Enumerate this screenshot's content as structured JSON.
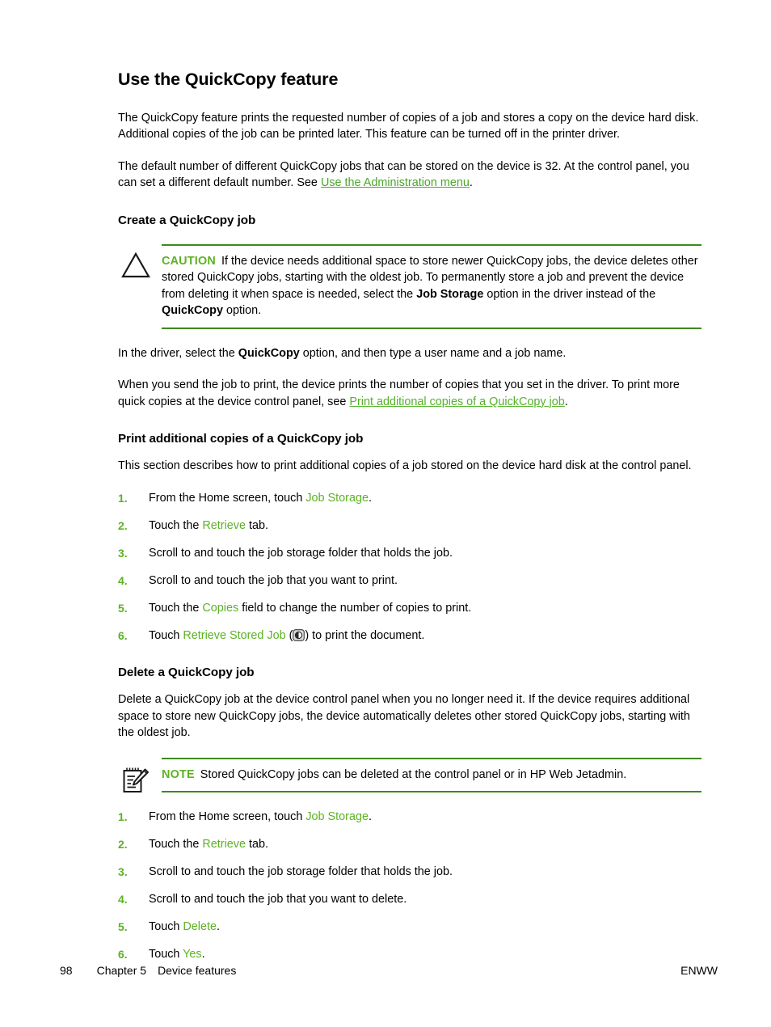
{
  "page": {
    "title": "Use the QuickCopy feature",
    "intro_paragraph": "The QuickCopy feature prints the requested number of copies of a job and stores a copy on the device hard disk. Additional copies of the job can be printed later. This feature can be turned off in the printer driver.",
    "default_paragraph_before_link": "The default number of different QuickCopy jobs that can be stored on the device is 32. At the control panel, you can set a different default number. See ",
    "default_paragraph_link": "Use the Administration menu",
    "default_paragraph_after_link": "."
  },
  "create_section": {
    "heading": "Create a QuickCopy job",
    "caution": {
      "icon": "caution-triangle-icon",
      "label": "CAUTION",
      "text_part1": "If the device needs additional space to store newer QuickCopy jobs, the device deletes other stored QuickCopy jobs, starting with the oldest job. To permanently store a job and prevent the device from deleting it when space is needed, select the ",
      "bold1": "Job Storage",
      "text_part2": " option in the driver instead of the ",
      "bold2": "QuickCopy",
      "text_part3": " option."
    },
    "driver_paragraph_part1": "In the driver, select the ",
    "driver_paragraph_bold": "QuickCopy",
    "driver_paragraph_part2": " option, and then type a user name and a job name.",
    "send_paragraph_before_link": "When you send the job to print, the device prints the number of copies that you set in the driver. To print more quick copies at the device control panel, see ",
    "send_paragraph_link": "Print additional copies of a QuickCopy job",
    "send_paragraph_after_link": "."
  },
  "print_section": {
    "heading": "Print additional copies of a QuickCopy job",
    "intro": "This section describes how to print additional copies of a job stored on the device hard disk at the control panel.",
    "steps": [
      {
        "num": "1.",
        "pre": "From the Home screen, touch ",
        "ui": "Job Storage",
        "post": "."
      },
      {
        "num": "2.",
        "pre": "Touch the ",
        "ui": "Retrieve",
        "post": " tab."
      },
      {
        "num": "3.",
        "pre": "Scroll to and touch the job storage folder that holds the job.",
        "ui": "",
        "post": ""
      },
      {
        "num": "4.",
        "pre": "Scroll to and touch the job that you want to print.",
        "ui": "",
        "post": ""
      },
      {
        "num": "5.",
        "pre": "Touch the ",
        "ui": "Copies",
        "post": " field to change the number of copies to print."
      },
      {
        "num": "6.",
        "pre": "Touch ",
        "ui": "Retrieve Stored Job",
        "post": " (",
        "icon": "start-button-icon",
        "post2": ") to print the document."
      }
    ]
  },
  "delete_section": {
    "heading": "Delete a QuickCopy job",
    "intro": "Delete a QuickCopy job at the device control panel when you no longer need it. If the device requires additional space to store new QuickCopy jobs, the device automatically deletes other stored QuickCopy jobs, starting with the oldest job.",
    "note": {
      "icon": "note-pad-pencil-icon",
      "label": "NOTE",
      "text": "Stored QuickCopy jobs can be deleted at the control panel or in HP Web Jetadmin."
    },
    "steps": [
      {
        "num": "1.",
        "pre": "From the Home screen, touch ",
        "ui": "Job Storage",
        "post": "."
      },
      {
        "num": "2.",
        "pre": "Touch the ",
        "ui": "Retrieve",
        "post": " tab."
      },
      {
        "num": "3.",
        "pre": "Scroll to and touch the job storage folder that holds the job.",
        "ui": "",
        "post": ""
      },
      {
        "num": "4.",
        "pre": "Scroll to and touch the job that you want to delete.",
        "ui": "",
        "post": ""
      },
      {
        "num": "5.",
        "pre": "Touch ",
        "ui": "Delete",
        "post": "."
      },
      {
        "num": "6.",
        "pre": "Touch ",
        "ui": "Yes",
        "post": "."
      }
    ]
  },
  "footer": {
    "page_number": "98",
    "chapter": "Chapter 5",
    "chapter_title": "Device features",
    "locale": "ENWW"
  },
  "colors": {
    "link_green": "#55B22C",
    "ui_green": "#5CB223",
    "rule_green": "#3C8A1C",
    "label_green": "#5CB223",
    "text_black": "#000000"
  }
}
